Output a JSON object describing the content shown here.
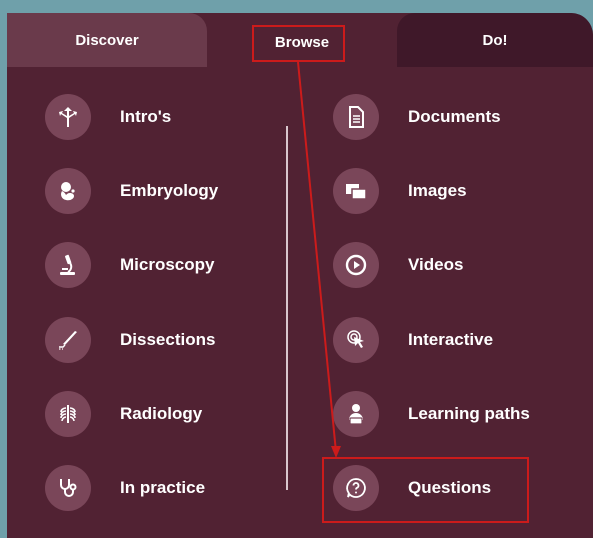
{
  "tabs": [
    {
      "label": "Discover"
    },
    {
      "label": "Browse"
    },
    {
      "label": "Do!"
    }
  ],
  "left_items": [
    {
      "label": "Intro's",
      "icon": "directions-icon"
    },
    {
      "label": "Embryology",
      "icon": "embryo-icon"
    },
    {
      "label": "Microscopy",
      "icon": "microscope-icon"
    },
    {
      "label": "Dissections",
      "icon": "scalpel-icon"
    },
    {
      "label": "Radiology",
      "icon": "ribcage-icon"
    },
    {
      "label": "In practice",
      "icon": "stethoscope-icon"
    }
  ],
  "right_items": [
    {
      "label": "Documents",
      "icon": "document-icon"
    },
    {
      "label": "Images",
      "icon": "images-icon"
    },
    {
      "label": "Videos",
      "icon": "play-icon"
    },
    {
      "label": "Interactive",
      "icon": "pointer-click-icon"
    },
    {
      "label": "Learning paths",
      "icon": "learner-icon"
    },
    {
      "label": "Questions",
      "icon": "question-icon"
    }
  ],
  "colors": {
    "panel": "#512233",
    "icon_circle": "#7a4659",
    "highlight": "#cc1b1b"
  }
}
